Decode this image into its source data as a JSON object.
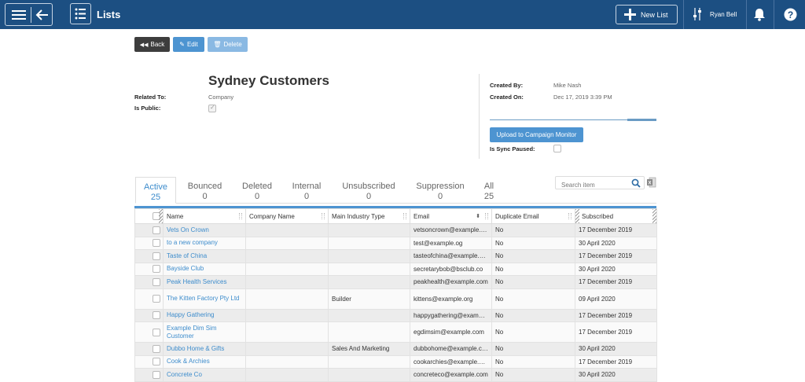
{
  "topbar": {
    "title": "Lists",
    "new_list_label": "New List",
    "user_name": "Ryan Bell",
    "icons": [
      "hamburger-icon",
      "back-arrow-icon",
      "list-icon",
      "plus-icon",
      "sliders-icon",
      "bell-icon",
      "help-icon"
    ]
  },
  "actions": {
    "back_label": "Back",
    "edit_label": "Edit",
    "delete_label": "Delete"
  },
  "detail": {
    "title": "Sydney Customers",
    "related_to_label": "Related To:",
    "related_to_value": "Company",
    "is_public_label": "Is Public:",
    "created_by_label": "Created By:",
    "created_by_value": "Mike Nash",
    "created_on_label": "Created On:",
    "created_on_value": "Dec 17, 2019 3:39 PM",
    "upload_label": "Upload to Campaign Monitor",
    "sync_paused_label": "Is Sync Paused:"
  },
  "tabs": [
    {
      "label": "Active",
      "count": "25"
    },
    {
      "label": "Bounced",
      "count": "0"
    },
    {
      "label": "Deleted",
      "count": "0"
    },
    {
      "label": "Internal",
      "count": "0"
    },
    {
      "label": "Unsubscribed",
      "count": "0"
    },
    {
      "label": "Suppression",
      "count": "0"
    },
    {
      "label": "All",
      "count": "25"
    }
  ],
  "search": {
    "placeholder": "Search item"
  },
  "table": {
    "columns": [
      "Name",
      "Company Name",
      "Main Industry Type",
      "Email",
      "Duplicate Email",
      "Subscribed"
    ],
    "rows": [
      {
        "name": "Vets On Crown",
        "company": "",
        "industry": "",
        "email": "vetsoncrown@example.com",
        "dup": "No",
        "subscribed": "17 December 2019"
      },
      {
        "name": "to a new company",
        "company": "",
        "industry": "",
        "email": "test@example.og",
        "dup": "No",
        "subscribed": "30 April 2020"
      },
      {
        "name": "Taste of China",
        "company": "",
        "industry": "",
        "email": "tasteofchina@example.com",
        "dup": "No",
        "subscribed": "17 December 2019"
      },
      {
        "name": "Bayside Club",
        "company": "",
        "industry": "",
        "email": "secretarybob@bsclub.co",
        "dup": "No",
        "subscribed": "30 April 2020"
      },
      {
        "name": "Peak Health Services",
        "company": "",
        "industry": "",
        "email": "peakhealth@example.com",
        "dup": "No",
        "subscribed": "17 December 2019"
      },
      {
        "name": "The Kitten Factory Pty Ltd",
        "company": "",
        "industry": "Builder",
        "email": "kittens@example.org",
        "dup": "No",
        "subscribed": "09 April 2020"
      },
      {
        "name": "Happy Gathering",
        "company": "",
        "industry": "",
        "email": "happygathering@example.com",
        "dup": "No",
        "subscribed": "17 December 2019"
      },
      {
        "name": "Example Dim Sim Customer",
        "company": "",
        "industry": "",
        "email": "egdimsim@example.com",
        "dup": "No",
        "subscribed": "17 December 2019"
      },
      {
        "name": "Dubbo Home & Gifts",
        "company": "",
        "industry": "Sales And Marketing",
        "email": "dubbohome@example.com",
        "dup": "No",
        "subscribed": "30 April 2020"
      },
      {
        "name": "Cook & Archies",
        "company": "",
        "industry": "",
        "email": "cookarchies@example.com",
        "dup": "No",
        "subscribed": "17 December 2019"
      },
      {
        "name": "Concrete Co",
        "company": "",
        "industry": "",
        "email": "concreteco@example.com",
        "dup": "No",
        "subscribed": "30 April 2020"
      }
    ]
  },
  "colors": {
    "topbar": "#1c4f82",
    "accent": "#4d94d1",
    "link": "#3d8ccc",
    "dark_button": "#3d3d3d"
  }
}
